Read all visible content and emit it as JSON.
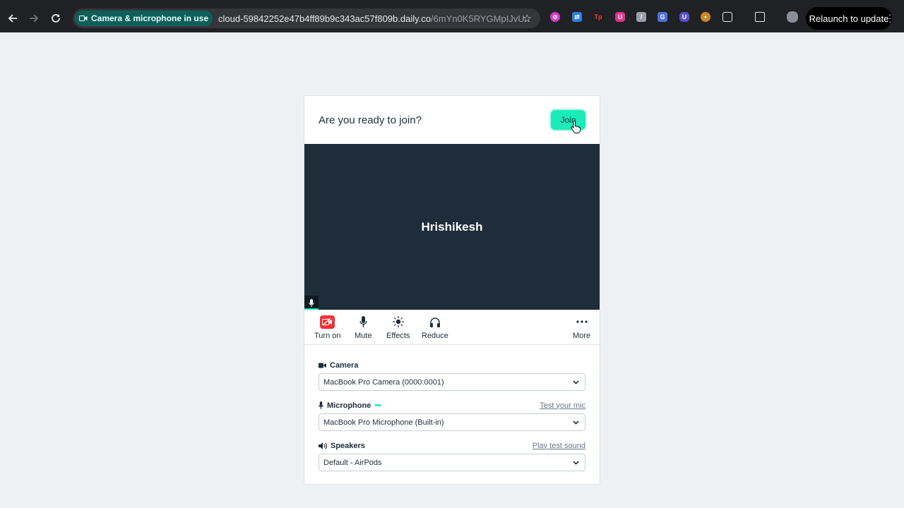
{
  "browser": {
    "camera_chip_label": "Camera & microphone in use",
    "url_main": "cloud-59842252e47b4ff89b9c343ac57f809b.daily.co",
    "url_rest": "/6mYn0K5RYGMpIJvU...",
    "relaunch_label": "Relaunch to update"
  },
  "card": {
    "title": "Are you ready to join?",
    "join_label": "Join",
    "participant_name": "Hrishikesh"
  },
  "controls": [
    {
      "label": "Turn on",
      "icon": "camera-off-icon"
    },
    {
      "label": "Mute",
      "icon": "microphone-icon"
    },
    {
      "label": "Effects",
      "icon": "sparkle-icon"
    },
    {
      "label": "Reduce",
      "icon": "headphones-icon"
    },
    {
      "label": "More",
      "icon": "more-icon"
    }
  ],
  "settings": {
    "camera": {
      "label": "Camera",
      "value": "MacBook Pro Camera (0000:0001)"
    },
    "microphone": {
      "label": "Microphone",
      "value": "MacBook Pro Microphone (Built-in)",
      "link": "Test your mic",
      "level_dots": "•••"
    },
    "speakers": {
      "label": "Speakers",
      "value": "Default - AirPods",
      "link": "Play test sound"
    }
  },
  "colors": {
    "accent": "#1bebb9",
    "video_bg": "#1f2d3a",
    "camera_off": "#f63135"
  }
}
